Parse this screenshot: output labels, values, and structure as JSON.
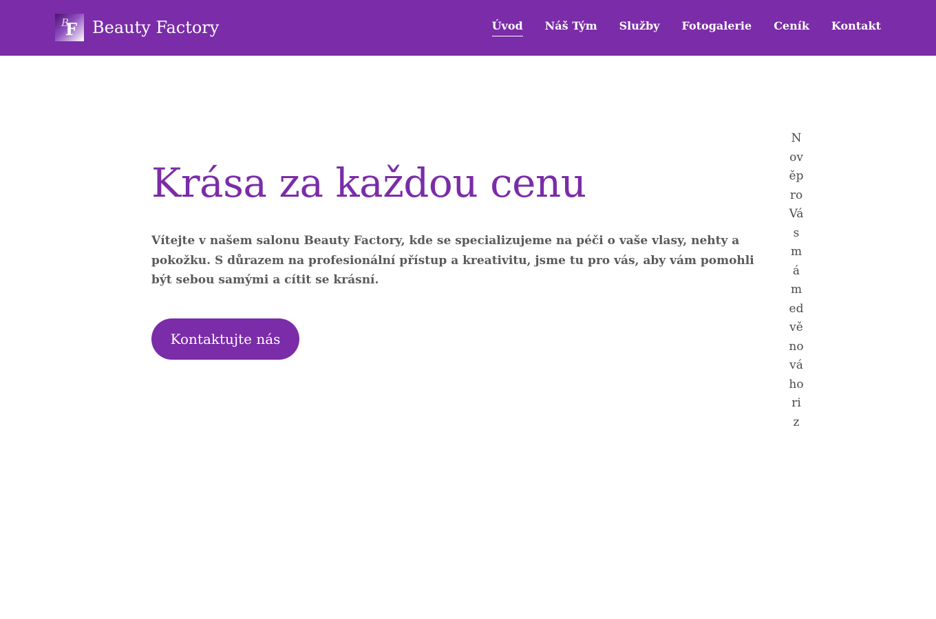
{
  "brand": {
    "name": "Beauty Factory",
    "logo_letters": "F",
    "logo_small": "B"
  },
  "nav": {
    "items": [
      {
        "label": "Úvod",
        "active": true
      },
      {
        "label": "Náš Tým",
        "active": false
      },
      {
        "label": "Služby",
        "active": false
      },
      {
        "label": "Fotogalerie",
        "active": false
      },
      {
        "label": "Ceník",
        "active": false
      },
      {
        "label": "Kontakt",
        "active": false
      }
    ]
  },
  "hero": {
    "title": "Krása za každou cenu",
    "text": "Vítejte v našem salonu Beauty Factory, kde se specializujeme na péči o vaše vlasy, nehty a pokožku. S důrazem na profesionální přístup a kreativitu, jsme tu pro vás, aby vám pomohli být sebou samými a cítit se krásní.",
    "cta_label": "Kontaktujte nás"
  },
  "side_notice": {
    "text": "NověproVásmámedvěnováhoriz"
  },
  "colors": {
    "primary": "#7b2ca8",
    "text": "#5a5a5a"
  }
}
